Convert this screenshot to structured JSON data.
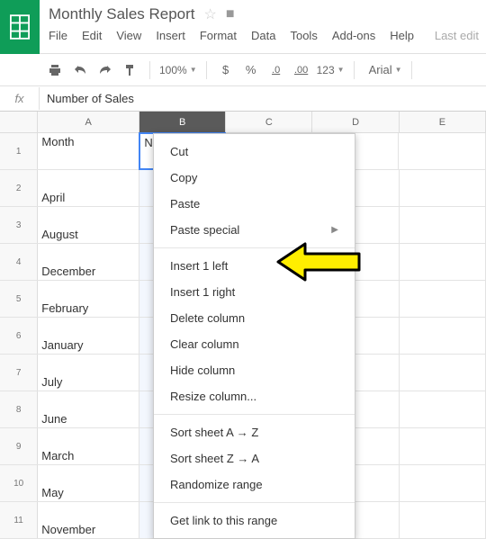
{
  "doc_title": "Monthly Sales Report",
  "menu": {
    "file": "File",
    "edit": "Edit",
    "view": "View",
    "insert": "Insert",
    "format": "Format",
    "data": "Data",
    "tools": "Tools",
    "addons": "Add-ons",
    "help": "Help",
    "last_edit": "Last edit"
  },
  "toolbar": {
    "zoom": "100%",
    "currency": "$",
    "percent": "%",
    "dec_less": ".0",
    "dec_more": ".00",
    "num_format": "123",
    "font": "Arial"
  },
  "formula_value": "Number of Sales",
  "columns": {
    "a": "A",
    "b": "B",
    "c": "C",
    "d": "D",
    "e": "E"
  },
  "rows": [
    {
      "num": "1",
      "a": "Month",
      "b": "Num"
    },
    {
      "num": "2",
      "a": "April",
      "b": ""
    },
    {
      "num": "3",
      "a": "August",
      "b": ""
    },
    {
      "num": "4",
      "a": "December",
      "b": ""
    },
    {
      "num": "5",
      "a": "February",
      "b": ""
    },
    {
      "num": "6",
      "a": "January",
      "b": ""
    },
    {
      "num": "7",
      "a": "July",
      "b": ""
    },
    {
      "num": "8",
      "a": "June",
      "b": ""
    },
    {
      "num": "9",
      "a": "March",
      "b": ""
    },
    {
      "num": "10",
      "a": "May",
      "b": ""
    },
    {
      "num": "11",
      "a": "November",
      "b": ""
    }
  ],
  "context_menu": {
    "cut": "Cut",
    "copy": "Copy",
    "paste": "Paste",
    "paste_special": "Paste special",
    "insert_left": "Insert 1 left",
    "insert_right": "Insert 1 right",
    "delete_col": "Delete column",
    "clear_col": "Clear column",
    "hide_col": "Hide column",
    "resize_col": "Resize column...",
    "sort_az": "Sort sheet A → Z",
    "sort_za": "Sort sheet Z → A",
    "randomize": "Randomize range",
    "get_link": "Get link to this range"
  }
}
